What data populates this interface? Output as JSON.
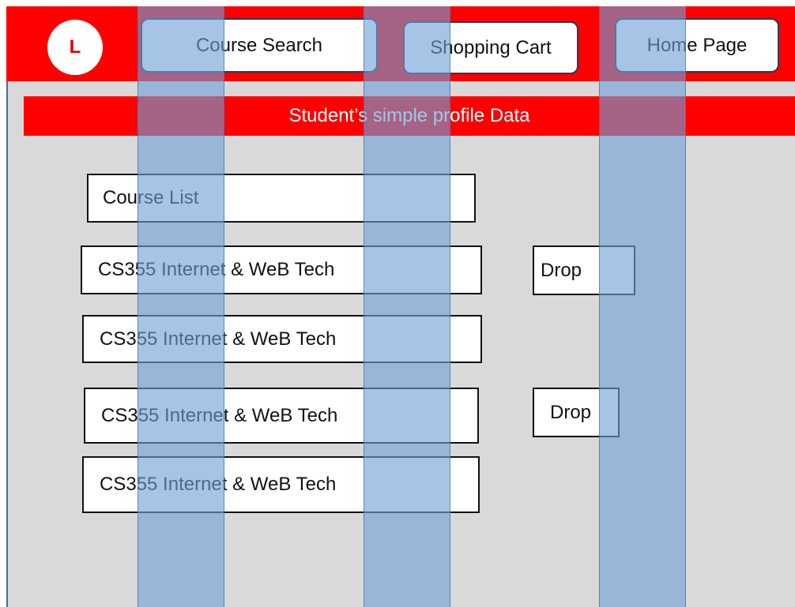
{
  "header": {
    "logo_letter": "L",
    "nav": {
      "course_search": "Course Search",
      "shopping_cart": "Shopping Cart",
      "home_page": "Home Page"
    }
  },
  "profile": {
    "banner_text": "Student’s simple profile Data"
  },
  "course_list": {
    "header": "Course List",
    "items": [
      {
        "label": "CS355 Internet & WeB Tech",
        "action": "Drop"
      },
      {
        "label": "CS355 Internet & WeB Tech"
      },
      {
        "label": "CS355 Internet & WeB Tech",
        "action": "Drop"
      },
      {
        "label": "CS355 Internet & WeB Tech"
      }
    ]
  },
  "colors": {
    "brand_red": "#ff0000",
    "canvas_gray": "#d9d9d9",
    "overlay_blue": "#6ea0d7"
  }
}
